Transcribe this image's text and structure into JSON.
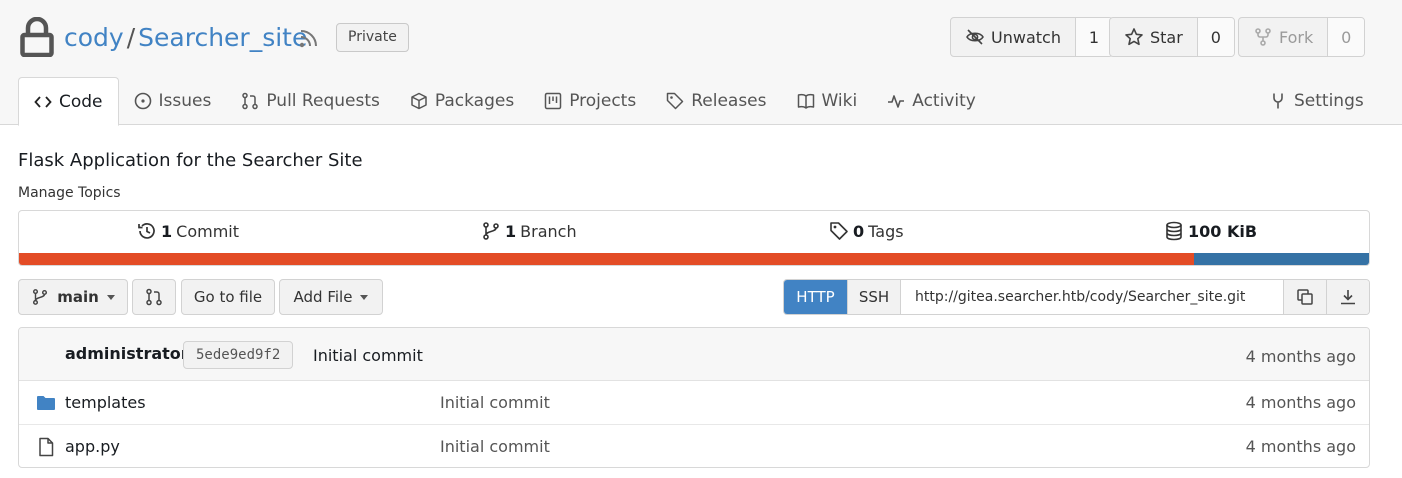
{
  "repo": {
    "owner": "cody",
    "separator": "/",
    "name": "Searcher_site",
    "visibility_badge": "Private",
    "description": "Flask Application for the Searcher Site",
    "manage_topics": "Manage Topics"
  },
  "actions": {
    "unwatch": {
      "label": "Unwatch",
      "count": "1",
      "icon": "eye-slash-icon"
    },
    "star": {
      "label": "Star",
      "count": "0",
      "icon": "star-icon"
    },
    "fork": {
      "label": "Fork",
      "count": "0",
      "icon": "fork-icon",
      "disabled": true
    }
  },
  "tabs": [
    {
      "label": "Code",
      "icon": "code-icon",
      "active": true
    },
    {
      "label": "Issues",
      "icon": "issue-icon"
    },
    {
      "label": "Pull Requests",
      "icon": "pull-request-icon"
    },
    {
      "label": "Packages",
      "icon": "package-icon"
    },
    {
      "label": "Projects",
      "icon": "project-icon"
    },
    {
      "label": "Releases",
      "icon": "tag-icon"
    },
    {
      "label": "Wiki",
      "icon": "book-icon"
    },
    {
      "label": "Activity",
      "icon": "pulse-icon"
    }
  ],
  "settings_tab": {
    "label": "Settings",
    "icon": "tools-icon"
  },
  "stats": {
    "commits": {
      "count": "1",
      "label": "Commit"
    },
    "branches": {
      "count": "1",
      "label": "Branch"
    },
    "tags": {
      "count": "0",
      "label": "Tags"
    },
    "size": {
      "value": "100 KiB"
    }
  },
  "language_bar": [
    {
      "share": 0.87,
      "color": "#e34c26"
    },
    {
      "share": 0.13,
      "color": "#3572a5"
    }
  ],
  "toolbar": {
    "branch": "main",
    "go_to_file": "Go to file",
    "add_file": "Add File"
  },
  "clone": {
    "http": "HTTP",
    "ssh": "SSH",
    "url": "http://gitea.searcher.htb/cody/Searcher_site.git"
  },
  "latest_commit": {
    "author": "administrator",
    "sha": "5ede9ed9f2",
    "message": "Initial commit",
    "time": "4 months ago"
  },
  "files": [
    {
      "name": "templates",
      "type": "folder",
      "message": "Initial commit",
      "time": "4 months ago"
    },
    {
      "name": "app.py",
      "type": "file",
      "message": "Initial commit",
      "time": "4 months ago"
    }
  ],
  "colors": {
    "link": "#4183c4",
    "primary_button": "#4183c4",
    "folder": "#4183c4"
  }
}
